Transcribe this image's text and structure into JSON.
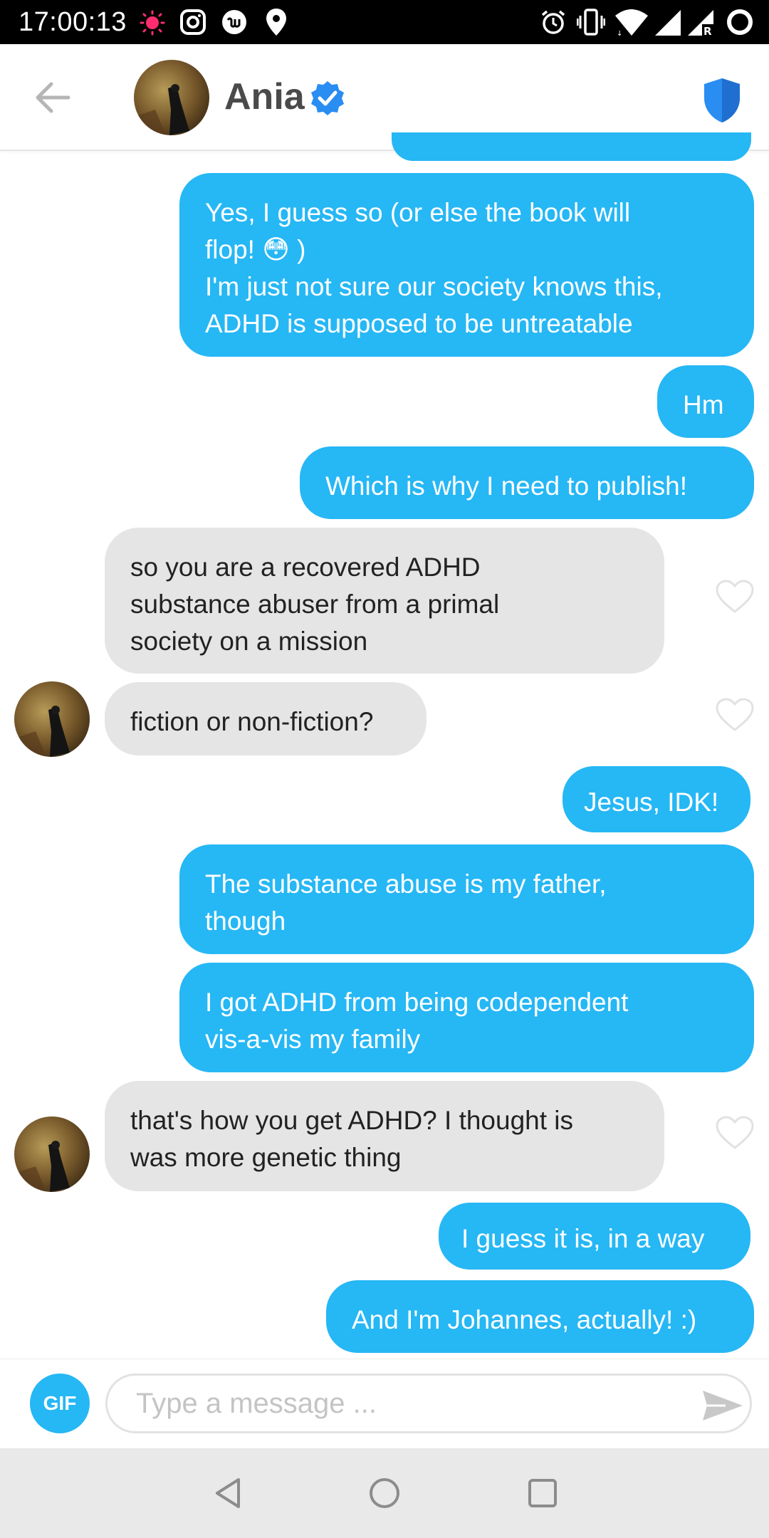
{
  "status_bar": {
    "time": "17:00:13",
    "left_icons": [
      "recording-dot-icon",
      "instagram-icon",
      "app-icon",
      "location-icon"
    ],
    "right_icons": [
      "alarm-icon",
      "vibrate-icon",
      "wifi-icon",
      "signal-icon",
      "signal-roaming-icon",
      "battery-icon"
    ]
  },
  "header": {
    "name": "Ania",
    "verified": true,
    "icons": [
      "back-arrow-icon",
      "verified-badge-icon",
      "shield-icon"
    ],
    "accent_color": "#26b7f5"
  },
  "messages": [
    {
      "side": "out",
      "text": "Yes, I guess so (or else the book will\nflop! 😳 )\nI'm just not sure our society knows this,\nADHD is supposed to be untreatable"
    },
    {
      "side": "out",
      "text": "Hm"
    },
    {
      "side": "out",
      "text": "Which is why I need to publish!"
    },
    {
      "side": "in",
      "text": "so you are a recovered ADHD\nsubstance abuser from a primal\nsociety on a mission",
      "liked": false
    },
    {
      "side": "in",
      "text": "fiction or non-fiction?",
      "liked": false,
      "avatar": true
    },
    {
      "side": "out",
      "text": "Jesus, IDK!"
    },
    {
      "side": "out",
      "text": "The substance abuse is my father,\nthough"
    },
    {
      "side": "out",
      "text": "I got ADHD from being codependent\nvis-a-vis my family"
    },
    {
      "side": "in",
      "text": "that's how you get ADHD? I thought is\nwas more genetic thing",
      "liked": false,
      "avatar": true
    },
    {
      "side": "out",
      "text": "I guess it is, in a way"
    },
    {
      "side": "out",
      "text": "And I'm Johannes, actually! :)"
    }
  ],
  "composer": {
    "gif_label": "GIF",
    "placeholder": "Type a message ...",
    "value": ""
  },
  "nav": {
    "icons": [
      "nav-back-icon",
      "nav-home-icon",
      "nav-recents-icon"
    ]
  },
  "colors": {
    "outgoing_bubble": "#26b7f5",
    "incoming_bubble": "#e5e5e5"
  }
}
